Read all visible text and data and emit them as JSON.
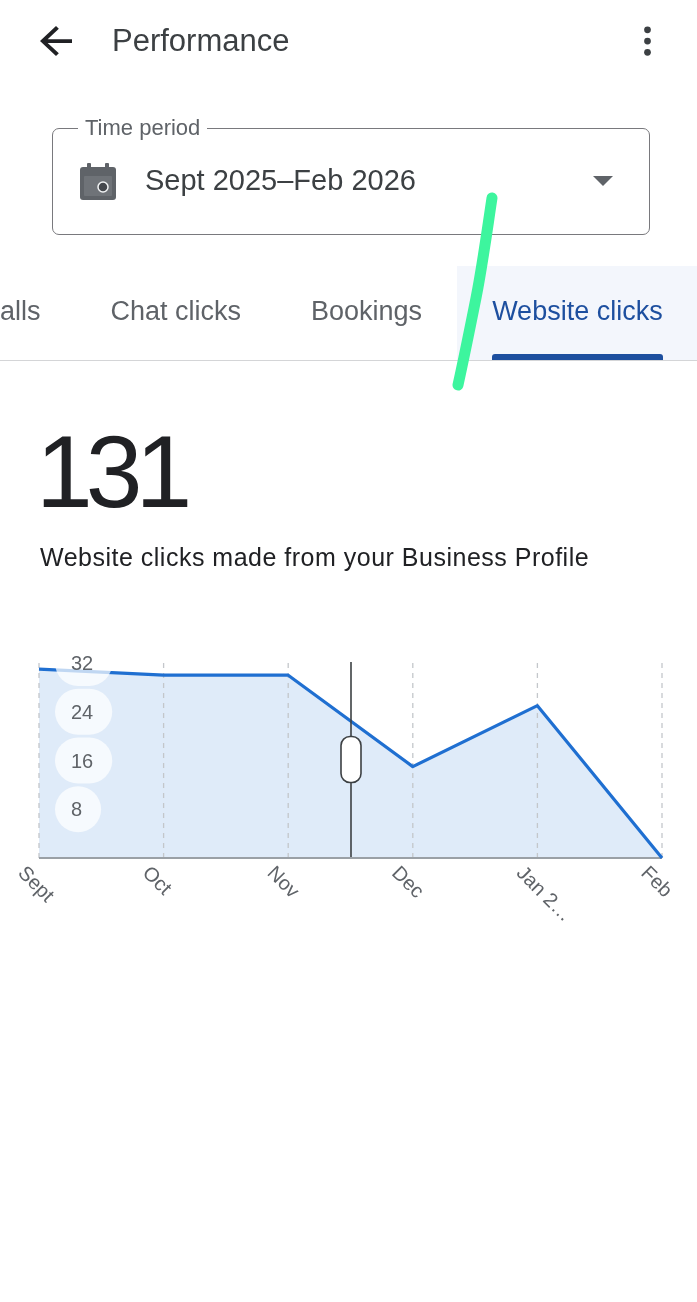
{
  "header": {
    "title": "Performance"
  },
  "time_period": {
    "label": "Time period",
    "value": "Sept 2025–Feb 2026"
  },
  "tabs": [
    {
      "label": "alls",
      "selected": false
    },
    {
      "label": "Chat clicks",
      "selected": false
    },
    {
      "label": "Bookings",
      "selected": false
    },
    {
      "label": "Website clicks",
      "selected": true
    }
  ],
  "summary": {
    "total": "131",
    "caption": "Website clicks made from your Business Profile"
  },
  "chart": {
    "chart_data": {
      "type": "area",
      "categories": [
        "Sept",
        "Oct",
        "Nov",
        "Dec",
        "Jan 2…",
        "Feb"
      ],
      "series": [
        {
          "color": "#1f6fd1",
          "values": [
            31,
            30,
            30,
            15,
            25,
            0
          ]
        }
      ],
      "ylim": [
        0,
        32
      ],
      "yticks": [
        8,
        16,
        24,
        32
      ],
      "grid": true
    },
    "scrubber": {
      "level": 0.5
    }
  }
}
